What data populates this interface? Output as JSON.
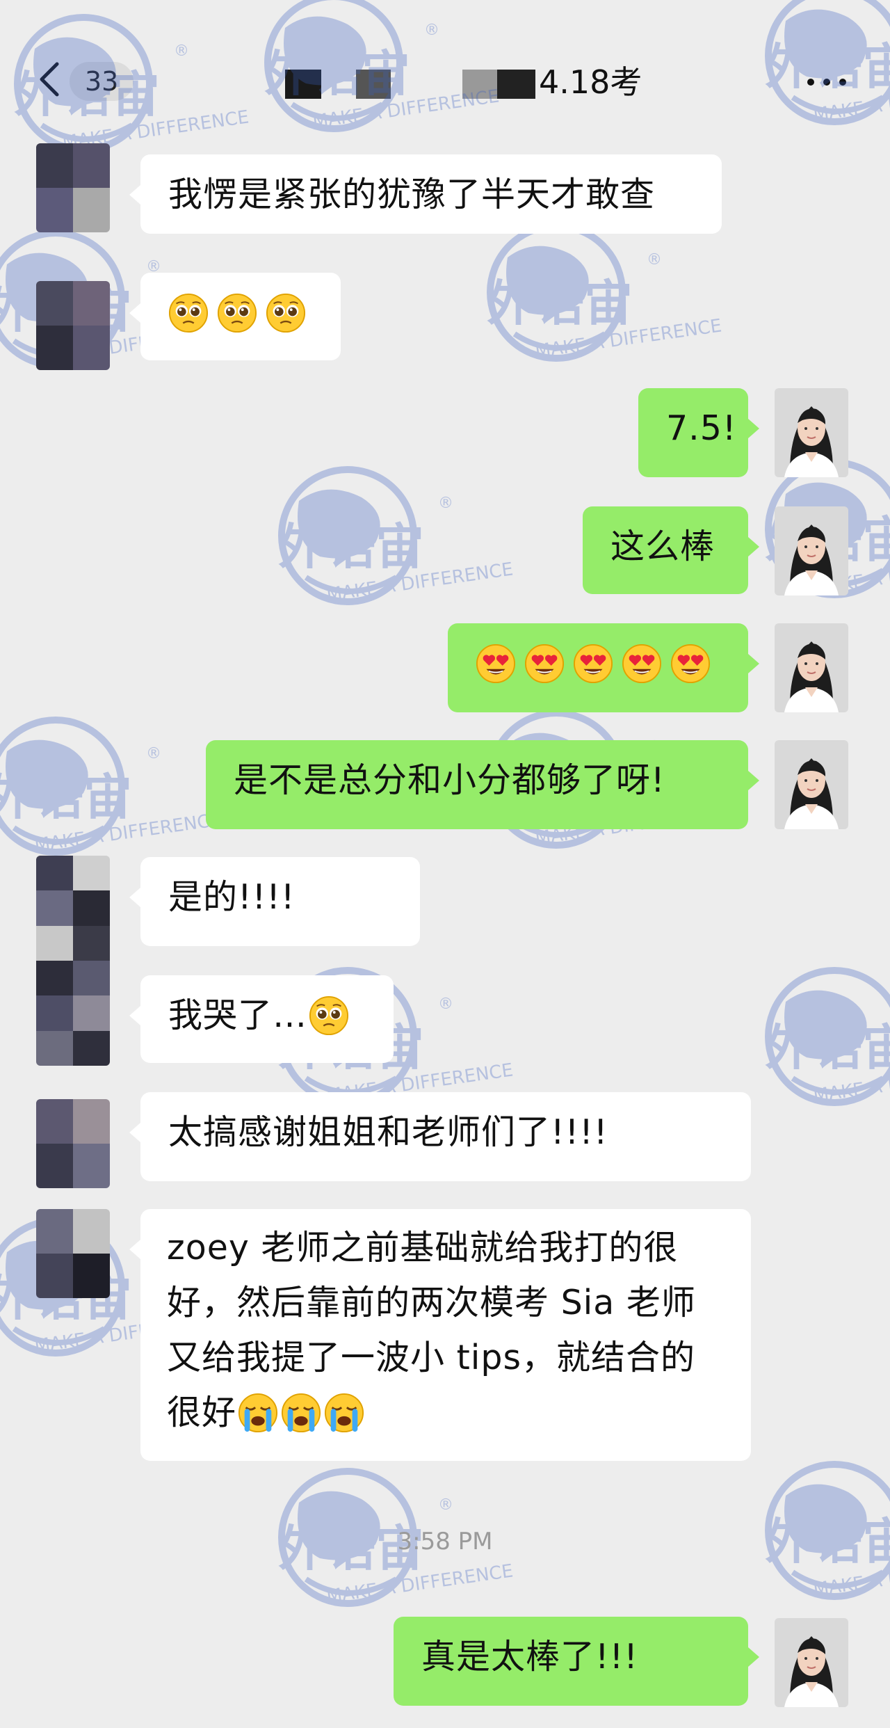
{
  "header": {
    "unread_count": "33",
    "title": "4.18考",
    "back_icon": "chevron-left-icon",
    "more_icon": "more-icon"
  },
  "watermark": {
    "brand": "外语宙",
    "slogan": "MAKE A DIFFERENCE",
    "registered": "®"
  },
  "messages": [
    {
      "side": "left",
      "text": "我愣是紧张的犹豫了半天才敢查"
    },
    {
      "side": "left",
      "emoji": "pleading-face",
      "count": 3
    },
    {
      "side": "right",
      "text": "7.5!"
    },
    {
      "side": "right",
      "text": "这么棒"
    },
    {
      "side": "right",
      "emoji": "heart-eyes-face",
      "count": 5
    },
    {
      "side": "right",
      "text": "是不是总分和小分都够了呀!"
    },
    {
      "side": "left",
      "text": "是的!!!!"
    },
    {
      "side": "left",
      "text": "我哭了…",
      "emoji": "pleading-face"
    },
    {
      "side": "left",
      "text": "太搞感谢姐姐和老师们了!!!!"
    },
    {
      "side": "left",
      "lines": [
        "zoey 老师之前基础就给我打的很",
        "好，然后靠前的两次模考 Sia 老师",
        "又给我提了一波小 tips，就结合的",
        "很好"
      ],
      "emoji": "loudly-crying-face",
      "count": 3
    },
    {
      "side": "right",
      "text": "真是太棒了!!!"
    }
  ],
  "timestamp": "3:58 PM",
  "colors": {
    "background": "#ededed",
    "sent_bubble": "#95ec69",
    "received_bubble": "#ffffff",
    "watermark": "#3a5fc0"
  }
}
